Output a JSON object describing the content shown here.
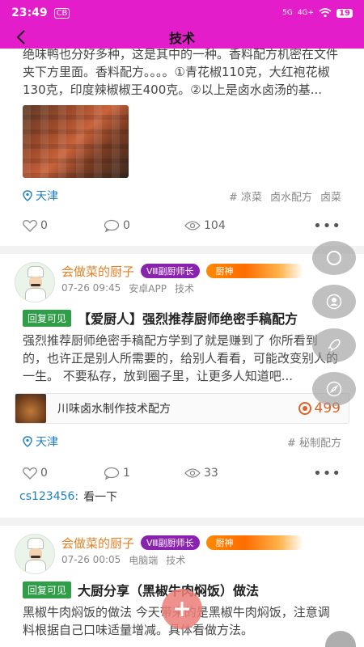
{
  "status_bar": {
    "time": "23:49",
    "app_indicator": "CB",
    "network_5g": "5G",
    "network_4g": "4G+",
    "battery": "19"
  },
  "nav": {
    "title": "技术"
  },
  "post1": {
    "text": "绝味鸭也分好多种，这是其中的一种。香料配方机密在文件夹下方里面。香料配方。。。。①青花椒110克，大红袍花椒130克，印度辣椒椒王400克。②以上是卤水卤汤的基...",
    "location": "天津",
    "tags": [
      "# 凉菜",
      "卤水配方",
      "卤菜"
    ],
    "likes": "0",
    "comments": "0",
    "views": "104"
  },
  "post2": {
    "author": "会做菜的厨子",
    "rank_badge": "Ⅷ副厨师长",
    "level_badge": "厨神",
    "date": "07-26 09:45",
    "platform": "安卓APP",
    "category": "技术",
    "reply_tag": "回复可见",
    "title": "【爱厨人】强烈推荐厨师绝密手稿配方",
    "text": "强烈推荐厨师绝密手稿配方学到了就是赚到了 你所看到的，也许正是别人所需要的，给别人看看，可能改变别人的一生。  不要私存，放到圈子里，让更多人知道吧...",
    "link_title": "川味卤水制作技术配方",
    "link_price": "499",
    "location": "天津",
    "tags": [
      "# 秘制配方"
    ],
    "likes": "0",
    "comments": "1",
    "views": "33",
    "comment_user": "cs123456:",
    "comment_text": "看一下"
  },
  "post3": {
    "author": "会做菜的厨子",
    "rank_badge": "Ⅷ副厨师长",
    "level_badge": "厨神",
    "date": "07-26 00:05",
    "platform": "电脑端",
    "category": "技术",
    "reply_tag": "回复可见",
    "title": "大厨分享（黑椒牛肉焖饭）做法",
    "text": "黑椒牛肉焖饭的做法 今天带来的是黑椒牛肉焖饭，注意调料根据自己口味适量增减。具体看做方法。"
  },
  "colors": {
    "brand": "#e21dc9",
    "author": "#e67e22",
    "location": "#1e7fc0",
    "reply_tag": "#2f9e47",
    "rank_badge": "#8a22b0"
  }
}
